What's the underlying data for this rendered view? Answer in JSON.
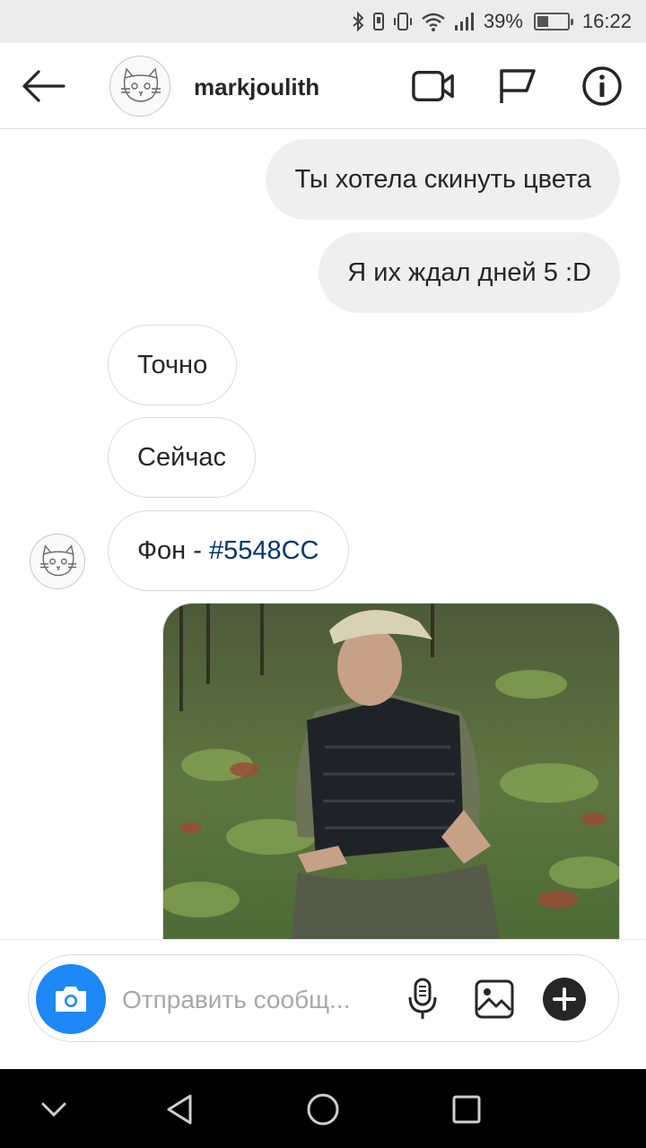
{
  "status_bar": {
    "battery_text": "39%",
    "battery_level": 0.39,
    "time": "16:22",
    "icons": [
      "bluetooth-icon",
      "vibrate-icon",
      "wifi-icon",
      "signal-icon",
      "battery-icon"
    ]
  },
  "header": {
    "username": "markjoulith",
    "icons": [
      "back-arrow-icon",
      "video-call-icon",
      "flag-icon",
      "info-icon"
    ]
  },
  "messages": [
    {
      "direction": "out",
      "text": "Ты хотела скинуть цвета"
    },
    {
      "direction": "out",
      "text": "Я их ждал дней 5 :D"
    },
    {
      "direction": "in",
      "text": "Точно"
    },
    {
      "direction": "in",
      "text": "Сейчас"
    },
    {
      "direction": "in",
      "text_prefix": "Фон - ",
      "link_text": "#5548CC"
    },
    {
      "direction": "out",
      "type": "photo"
    }
  ],
  "composer": {
    "placeholder": "Отправить сообщ...",
    "icons": [
      "camera-icon",
      "microphone-icon",
      "gallery-icon",
      "plus-icon"
    ]
  },
  "colors": {
    "accent": "#1E88F6",
    "out_bubble": "#EFEFEF",
    "link": "#00376B"
  },
  "nav": {
    "icons": [
      "chevron-down-icon",
      "back-triangle-icon",
      "home-circle-icon",
      "recents-square-icon"
    ]
  }
}
